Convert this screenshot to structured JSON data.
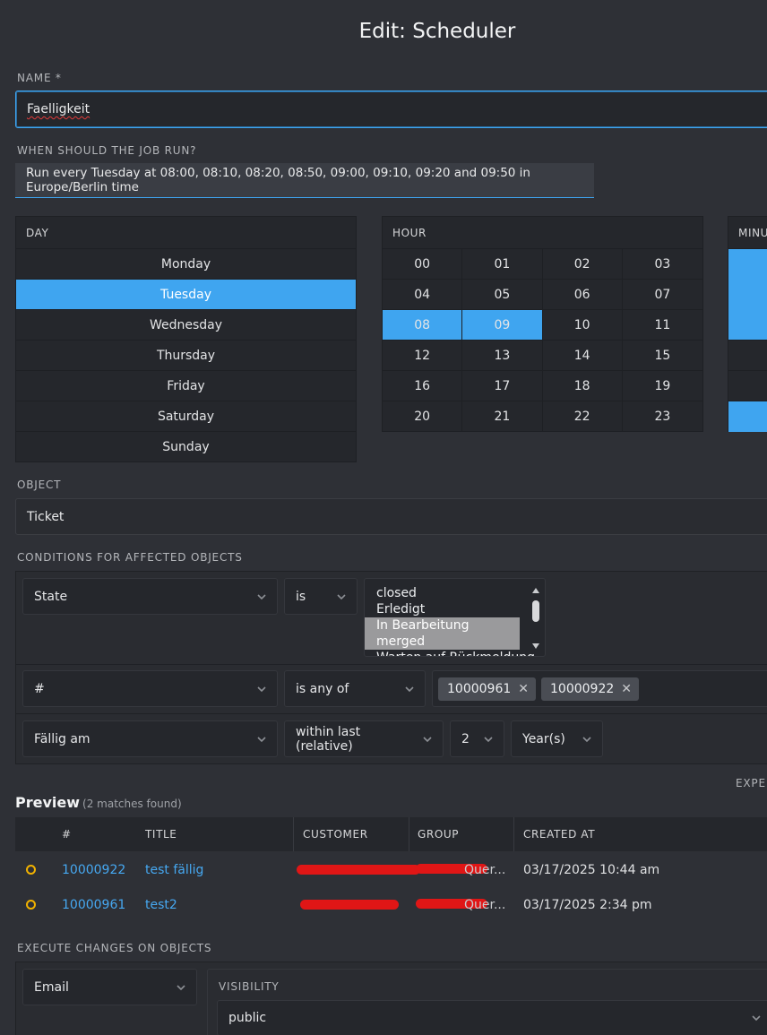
{
  "page": {
    "title": "Edit: Scheduler"
  },
  "name_field": {
    "label": "NAME *",
    "value": "Faelligkeit"
  },
  "timing": {
    "label": "WHEN SHOULD THE JOB RUN?",
    "description": "Run every Tuesday at 08:00, 08:10, 08:20, 08:50, 09:00, 09:10, 09:20 and 09:50 in Europe/Berlin time",
    "day_header": "DAY",
    "days": [
      {
        "label": "Monday",
        "selected": false
      },
      {
        "label": "Tuesday",
        "selected": true
      },
      {
        "label": "Wednesday",
        "selected": false
      },
      {
        "label": "Thursday",
        "selected": false
      },
      {
        "label": "Friday",
        "selected": false
      },
      {
        "label": "Saturday",
        "selected": false
      },
      {
        "label": "Sunday",
        "selected": false
      }
    ],
    "hour_header": "HOUR",
    "hours": [
      "00",
      "01",
      "02",
      "03",
      "04",
      "05",
      "06",
      "07",
      "08",
      "09",
      "10",
      "11",
      "12",
      "13",
      "14",
      "15",
      "16",
      "17",
      "18",
      "19",
      "20",
      "21",
      "22",
      "23"
    ],
    "selected_hours": [
      "08",
      "09"
    ],
    "minute_header": "MINU"
  },
  "object_field": {
    "label": "OBJECT",
    "value": "Ticket"
  },
  "conditions": {
    "label": "CONDITIONS FOR AFFECTED OBJECTS",
    "rows": [
      {
        "attribute": "State",
        "operator": "is",
        "options": [
          {
            "label": "closed",
            "selected": false
          },
          {
            "label": "Erledigt",
            "selected": false
          },
          {
            "label": "In Bearbeitung",
            "selected": true
          },
          {
            "label": "merged",
            "selected": true
          },
          {
            "label": "Warten auf Rückmeldung",
            "selected": false
          }
        ]
      },
      {
        "attribute": "#",
        "operator": "is any of",
        "tags": [
          "10000961",
          "10000922"
        ]
      },
      {
        "attribute": "Fällig am",
        "operator": "within last (relative)",
        "amount": "2",
        "unit": "Year(s)"
      }
    ],
    "expert_label": "EXPER"
  },
  "preview": {
    "title": "Preview",
    "count_text": "(2 matches found)",
    "columns": [
      "#",
      "TITLE",
      "CUSTOMER",
      "GROUP",
      "CREATED AT"
    ],
    "rows": [
      {
        "number": "10000922",
        "title": "test fällig",
        "group_suffix": "Quer...",
        "created": "03/17/2025 10:44 am"
      },
      {
        "number": "10000961",
        "title": "test2",
        "group_suffix": "Quer...",
        "created": "03/17/2025 2:34 pm"
      }
    ]
  },
  "execute": {
    "label": "EXECUTE CHANGES ON OBJECTS",
    "action": "Email",
    "visibility_label": "VISIBILITY",
    "visibility_value": "public"
  },
  "colors": {
    "accent": "#3fa5f0",
    "background": "#2e3036",
    "status_dot": "#f1b100",
    "redaction": "#e01616"
  }
}
